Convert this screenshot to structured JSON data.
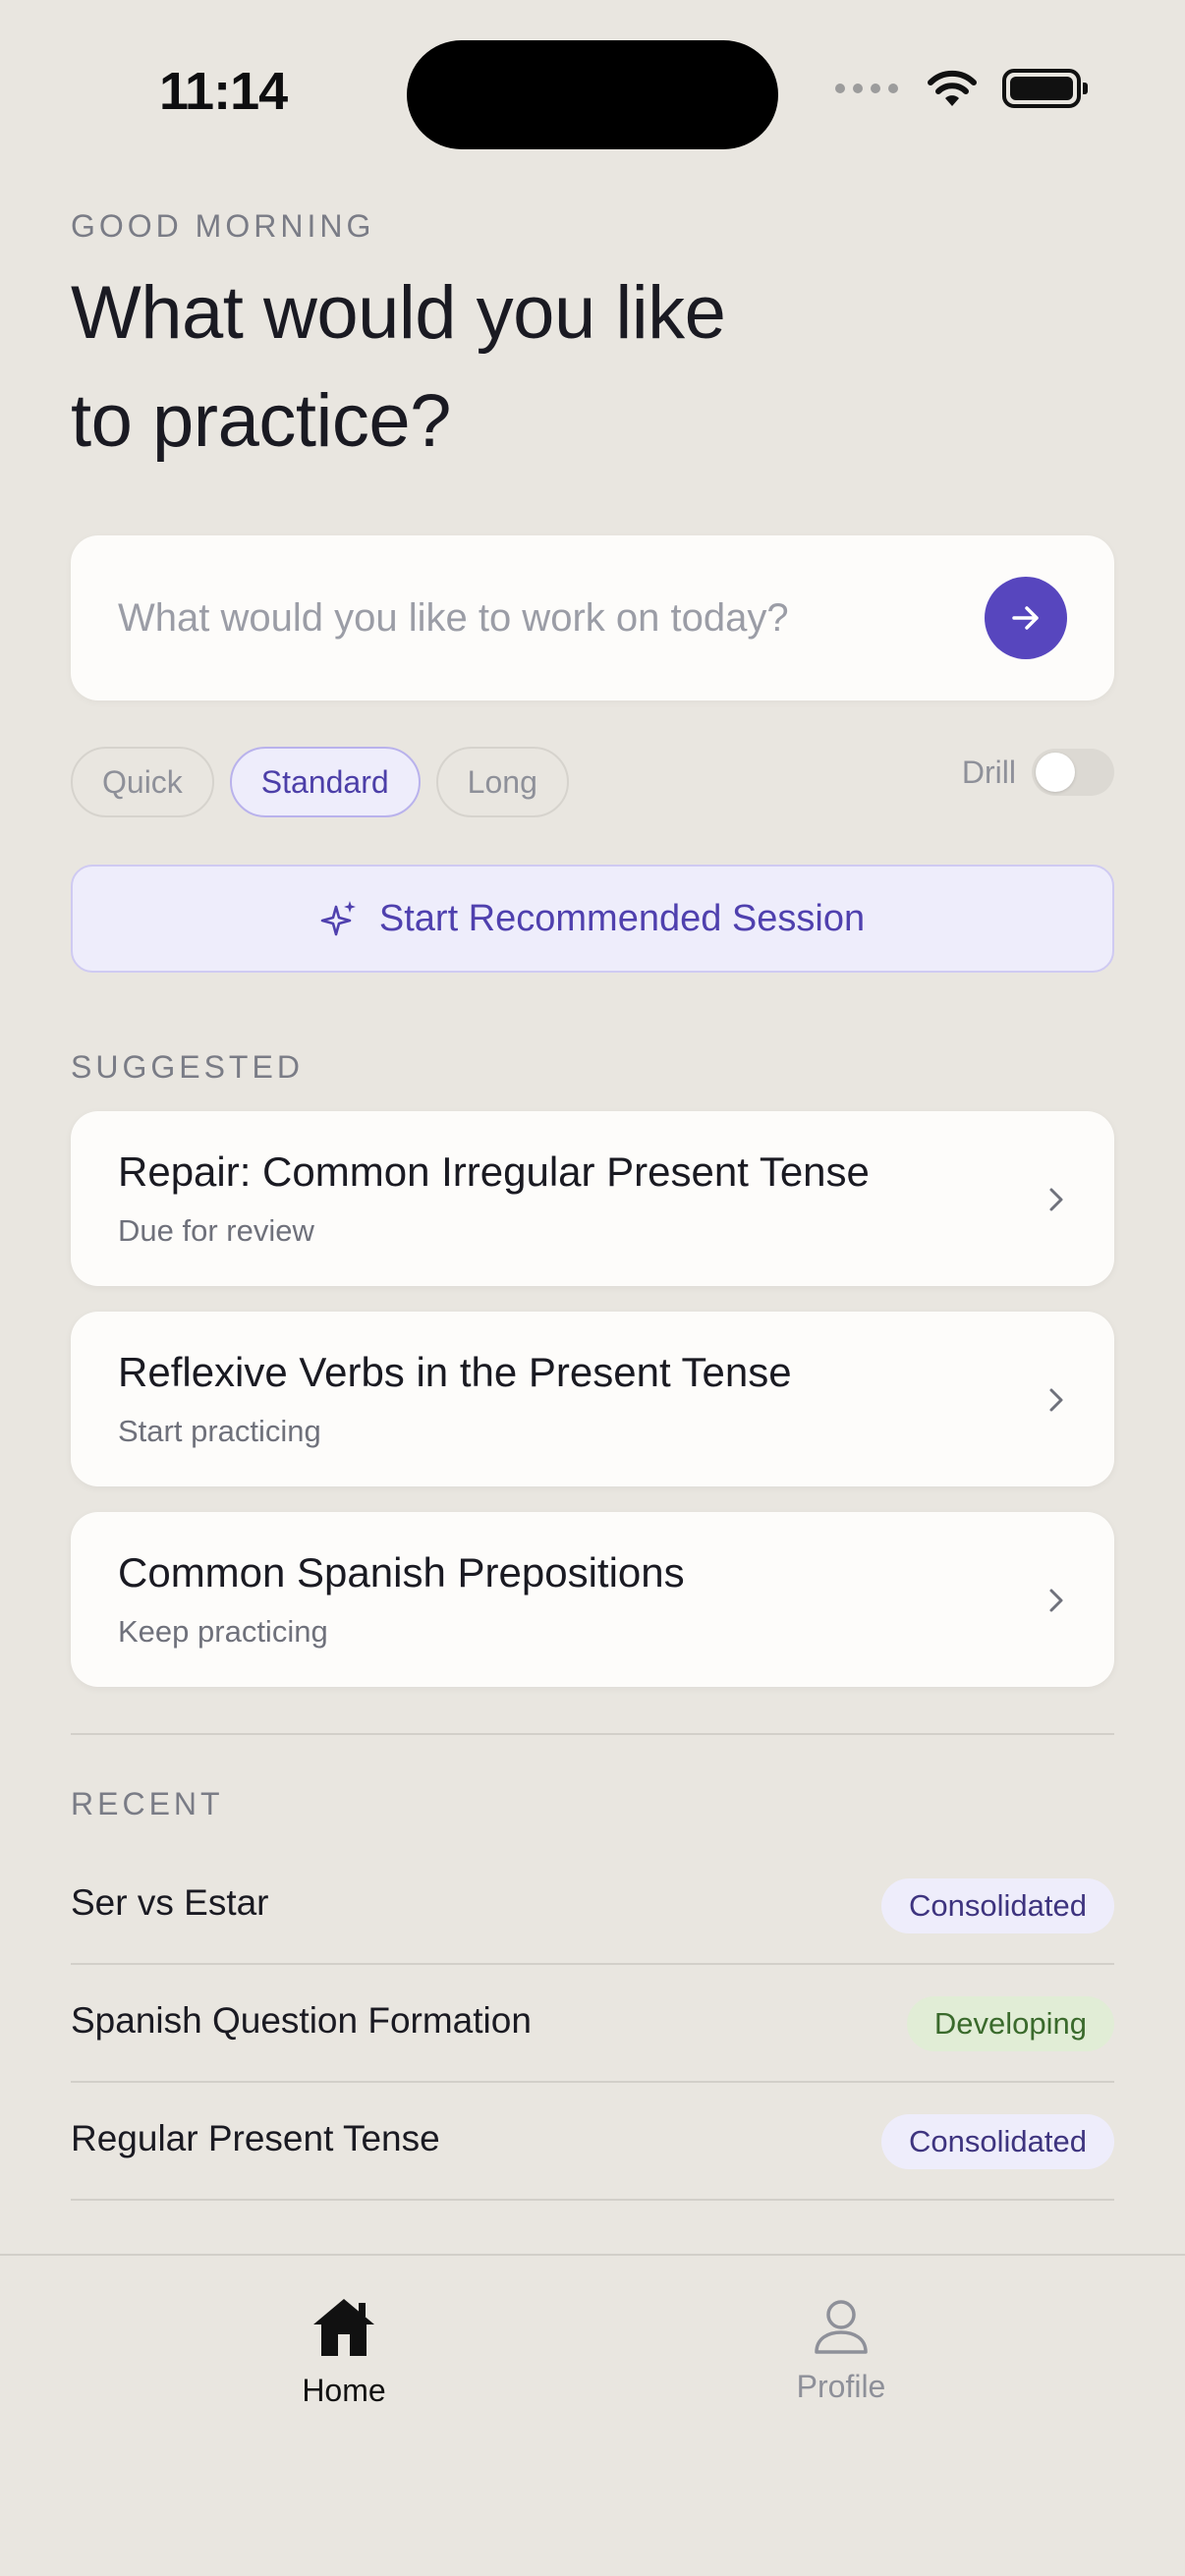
{
  "status_bar": {
    "time": "11:14"
  },
  "header": {
    "greeting": "GOOD MORNING",
    "headline": "What would you like to practice?"
  },
  "search": {
    "placeholder": "What would you like to work on today?",
    "value": ""
  },
  "length_options": [
    {
      "label": "Quick",
      "selected": false
    },
    {
      "label": "Standard",
      "selected": true
    },
    {
      "label": "Long",
      "selected": false
    }
  ],
  "drill": {
    "label": "Drill",
    "enabled": false
  },
  "recommend_button": {
    "label": "Start Recommended Session"
  },
  "suggested": {
    "section_label": "SUGGESTED",
    "items": [
      {
        "title": "Repair: Common Irregular Present Tense",
        "subtitle": "Due for review"
      },
      {
        "title": "Reflexive Verbs in the Present Tense",
        "subtitle": "Start practicing"
      },
      {
        "title": "Common Spanish Prepositions",
        "subtitle": "Keep practicing"
      }
    ]
  },
  "recent": {
    "section_label": "RECENT",
    "items": [
      {
        "title": "Ser vs Estar",
        "status": "Consolidated"
      },
      {
        "title": "Spanish Question Formation",
        "status": "Developing"
      },
      {
        "title": "Regular Present Tense",
        "status": "Consolidated"
      }
    ]
  },
  "tabbar": {
    "tabs": [
      {
        "label": "Home",
        "icon": "home-icon",
        "active": true
      },
      {
        "label": "Profile",
        "icon": "profile-icon",
        "active": false
      }
    ]
  },
  "colors": {
    "background": "#E9E6E0",
    "accent": "#5746BE",
    "accent_soft": "#EEEDFB",
    "developing": "#E1EDD6"
  }
}
